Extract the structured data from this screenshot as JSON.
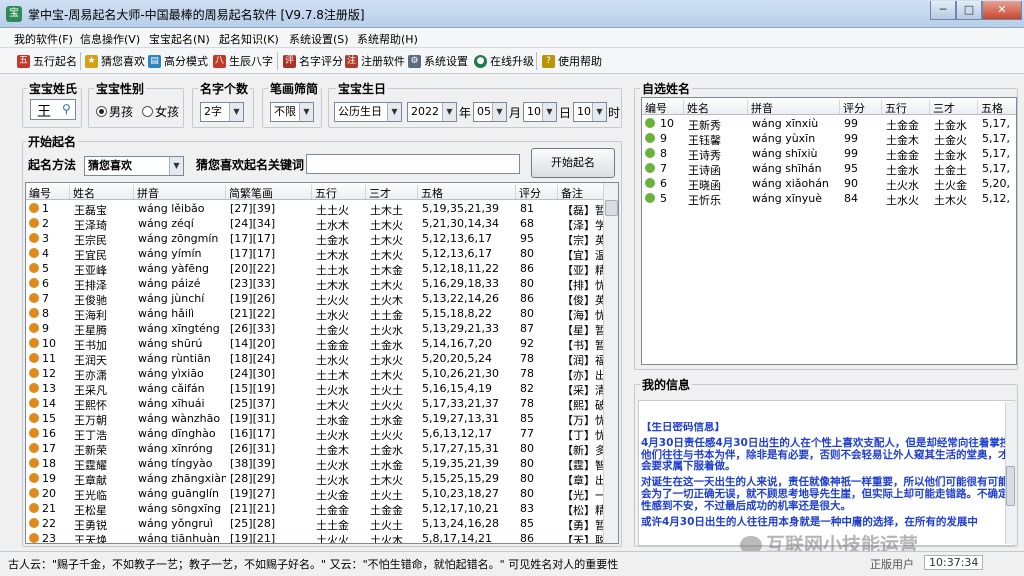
{
  "window": {
    "title": "掌中宝-周易起名大师-中国最棒的周易起名软件 [V9.7.8注册版]",
    "icon_char": "宝",
    "min": "─",
    "max": "□",
    "close": "✕"
  },
  "menu": [
    "我的软件(F)",
    "信息操作(V)",
    "宝宝起名(N)",
    "起名知识(K)",
    "系统设置(S)",
    "系统帮助(H)"
  ],
  "toolbar": [
    {
      "label": "五行起名",
      "icon": "wuxing-icon",
      "color": "#c0392b",
      "ch": "五"
    },
    {
      "label": "猜您喜欢",
      "icon": "star-icon",
      "color": "#d4a017",
      "ch": "★"
    },
    {
      "label": "高分模式",
      "icon": "chart-icon",
      "color": "#2e86c1",
      "ch": "▤"
    },
    {
      "label": "生辰八字",
      "icon": "calendar-icon",
      "color": "#c0392b",
      "ch": "八"
    },
    {
      "label": "名字评分",
      "icon": "score-icon",
      "color": "#a93226",
      "ch": "评"
    },
    {
      "label": "注册软件",
      "icon": "register-icon",
      "color": "#b03a2e",
      "ch": "注"
    },
    {
      "label": "系统设置",
      "icon": "settings-icon",
      "color": "#5d6d7e",
      "ch": "⚙"
    },
    {
      "label": "在线升级",
      "icon": "globe-icon",
      "color": "#1f7a4d",
      "ch": "●"
    },
    {
      "label": "使用帮助",
      "icon": "help-icon",
      "color": "#b7950b",
      "ch": "?"
    }
  ],
  "form": {
    "surname_label": "宝宝姓氏",
    "surname_value": "王",
    "gender_label": "宝宝性别",
    "gender_male": "男孩",
    "gender_female": "女孩",
    "count_label": "名字个数",
    "count_value": "2字",
    "strokes_label": "笔画筛简",
    "strokes_value": "不限",
    "birth_label": "宝宝生日",
    "calendar_type": "公历生日",
    "year": "2022",
    "year_unit": "年",
    "month": "05",
    "month_unit": "月",
    "day": "10",
    "day_unit": "日",
    "hour": "10",
    "hour_unit": "时"
  },
  "naming": {
    "group_label": "开始起名",
    "method_label": "起名方法",
    "method_value": "猜您喜欢",
    "keyword_label": "猜您喜欢起名关键词",
    "keyword_value": "",
    "start_button": "开始起名",
    "columns": [
      "编号",
      "姓名",
      "拼音",
      "简繁笔画",
      "五行",
      "三才",
      "五格",
      "评分",
      "备注"
    ],
    "rows": [
      [
        "1",
        "王磊宝",
        "wáng lěibǎo",
        "[27][39]",
        "土土火",
        "土木土",
        "5,19,35,21,39",
        "81",
        "【磊】暂无"
      ],
      [
        "2",
        "王泽琦",
        "wáng zéqí",
        "[24][34]",
        "土水木",
        "土木火",
        "5,21,30,14,34",
        "68",
        "【泽】学问丰"
      ],
      [
        "3",
        "王宗民",
        "wáng zōngmín",
        "[17][17]",
        "土金水",
        "土木火",
        "5,12,13,6,17",
        "95",
        "【宗】英俊"
      ],
      [
        "4",
        "王宜民",
        "wáng yímín",
        "[17][17]",
        "土木水",
        "土木火",
        "5,12,13,6,17",
        "80",
        "【宜】温和"
      ],
      [
        "5",
        "王亚峰",
        "wáng yàfēng",
        "[20][22]",
        "土土水",
        "土木金",
        "5,12,18,11,22",
        "86",
        "【亚】精神"
      ],
      [
        "6",
        "王排泽",
        "wáng páizé",
        "[23][33]",
        "土木水",
        "土木火",
        "5,16,29,18,33",
        "80",
        "【排】忧心"
      ],
      [
        "7",
        "王俊驰",
        "wáng jùnchí",
        "[19][26]",
        "土火火",
        "土火木",
        "5,13,22,14,26",
        "86",
        "【俊】英敏"
      ],
      [
        "8",
        "王海利",
        "wáng hǎilì",
        "[21][22]",
        "土水火",
        "土土金",
        "5,15,18,8,22",
        "80",
        "【海】忧心"
      ],
      [
        "9",
        "王星腾",
        "wáng xīngténg",
        "[26][33]",
        "土金火",
        "土火水",
        "5,13,29,21,33",
        "87",
        "【星】暂无"
      ],
      [
        "10",
        "王书加",
        "wáng shūrú",
        "[14][20]",
        "土金金",
        "土金水",
        "5,14,16,7,20",
        "92",
        "【书】暂无"
      ],
      [
        "11",
        "王润天",
        "wáng rùntiān",
        "[18][24]",
        "土水火",
        "土水火",
        "5,20,20,5,24",
        "78",
        "【润】福禄"
      ],
      [
        "12",
        "王亦潇",
        "wáng yìxiāo",
        "[24][30]",
        "土土木",
        "土木火",
        "5,10,26,21,30",
        "78",
        "【亦】出国"
      ],
      [
        "13",
        "王采凡",
        "wáng cǎifán",
        "[15][19]",
        "土火水",
        "土火土",
        "5,16,15,4,19",
        "82",
        "【采】清秀"
      ],
      [
        "14",
        "王熙怀",
        "wáng xīhuái",
        "[25][37]",
        "土木火",
        "土火火",
        "5,17,33,21,37",
        "78",
        "【熙】破相"
      ],
      [
        "15",
        "王万朝",
        "wáng wànzhāo",
        "[19][31]",
        "土水金",
        "土水金",
        "5,19,27,13,31",
        "85",
        "【万】忧心"
      ],
      [
        "16",
        "王丁浩",
        "wáng dīnghào",
        "[16][17]",
        "土火水",
        "土火火",
        "5,6,13,12,17",
        "77",
        "【丁】忧心"
      ],
      [
        "17",
        "王新荣",
        "wáng xīnróng",
        "[26][31]",
        "土金木",
        "土金水",
        "5,17,27,15,31",
        "80",
        "【新】多才"
      ],
      [
        "18",
        "王霆耀",
        "wáng tíngyào",
        "[38][39]",
        "土火水",
        "土水金",
        "5,19,35,21,39",
        "80",
        "【霆】智勇"
      ],
      [
        "19",
        "王章献",
        "wáng zhāngxiàn",
        "[28][29]",
        "土火水",
        "土木火",
        "5,15,25,15,29",
        "80",
        "【章】出外"
      ],
      [
        "20",
        "王光临",
        "wáng guānglín",
        "[19][27]",
        "土火金",
        "土火土",
        "5,10,23,18,27",
        "80",
        "【光】一生"
      ],
      [
        "21",
        "王松星",
        "wáng sōngxīng",
        "[21][21]",
        "土金金",
        "土金金",
        "5,12,17,10,21",
        "83",
        "【松】精明"
      ],
      [
        "22",
        "王勇锐",
        "wáng yǒngruì",
        "[25][28]",
        "土土金",
        "土火土",
        "5,13,24,16,28",
        "85",
        "【勇】暂无"
      ],
      [
        "23",
        "王天焕",
        "wáng tiānhuàn",
        "[19][21]",
        "土火火",
        "土火木",
        "5,8,17,14,21",
        "86",
        "【天】聪明"
      ]
    ]
  },
  "selected": {
    "group_label": "自选姓名",
    "columns": [
      "编号",
      "姓名",
      "拼音",
      "评分",
      "五行",
      "三才",
      "五格"
    ],
    "rows": [
      [
        "10",
        "王新秀",
        "wáng xīnxiù",
        "99",
        "土金金",
        "土金水",
        "5,17,"
      ],
      [
        "9",
        "王钰馨",
        "wáng yùxīn",
        "99",
        "土金木",
        "土金火",
        "5,17,"
      ],
      [
        "8",
        "王诗秀",
        "wáng shīxiù",
        "99",
        "土金金",
        "土金水",
        "5,17,"
      ],
      [
        "7",
        "王诗函",
        "wáng shīhán",
        "95",
        "土金水",
        "土金土",
        "5,17,"
      ],
      [
        "6",
        "王晓函",
        "wáng xiǎohán",
        "90",
        "土火水",
        "土火金",
        "5,20,"
      ],
      [
        "5",
        "王忻乐",
        "wáng xīnyuè",
        "84",
        "土水火",
        "土木火",
        "5,12,"
      ]
    ]
  },
  "myinfo": {
    "group_label": "我的信息",
    "heading": "【生日密码信息】",
    "paragraphs": [
      "4月30日责任感4月30日出生的人在个性上喜欢支配人，但是却经常向往着掌控他们往往与书本为伴，除非是有必要，否则不会轻易让外人窥其生活的堂奥，才会要求属下服着做。",
      "对诞生在这一天出生的人来说，责任就像神祇一样重要，所以他们可能很有可能会为了一切正确无误，就不顾思考地导先生崖，但实际上却可能走错路。不确定性感到不安，不过最后成功的机率还是很大。",
      "或许4月30日出生的人往往用本身就是一种中庸的选择，在所有的发展中"
    ]
  },
  "statusbar": {
    "quote": "古人云：\"赐子千金，不如教子一艺；教子一艺，不如赐子好名。\" 又云：\"不怕生错命，就怕起错名。\" 可见姓名对人的重要性!",
    "user": "正版用户",
    "time": "10:37:34"
  },
  "watermark": "互联网小技能运营"
}
